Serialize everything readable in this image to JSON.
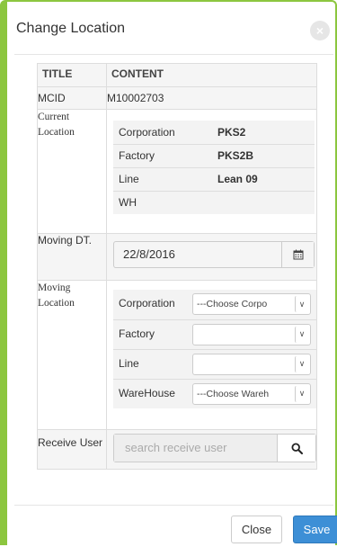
{
  "dialog": {
    "title": "Change Location",
    "close_icon": "×"
  },
  "table": {
    "headers": [
      "TITLE",
      "CONTENT"
    ],
    "mcid": {
      "label": "MCID",
      "value": "M10002703"
    },
    "current_location": {
      "label": "Current Location",
      "rows": [
        {
          "key": "Corporation",
          "value": "PKS2"
        },
        {
          "key": "Factory",
          "value": "PKS2B"
        },
        {
          "key": "Line",
          "value": "Lean 09"
        },
        {
          "key": "WH",
          "value": ""
        }
      ]
    },
    "moving_dt": {
      "label": "Moving DT.",
      "value": "22/8/2016",
      "icon": "calendar-icon"
    },
    "moving_location": {
      "label": "Moving Location",
      "rows": [
        {
          "key": "Corporation",
          "selected": "---Choose Corpo"
        },
        {
          "key": "Factory",
          "selected": ""
        },
        {
          "key": "Line",
          "selected": ""
        },
        {
          "key": "WareHouse",
          "selected": "---Choose Wareh"
        }
      ]
    },
    "receive_user": {
      "label": "Receive User",
      "placeholder": "search receive user",
      "icon": "search-icon"
    }
  },
  "footer": {
    "close_label": "Close",
    "save_label": "Save"
  },
  "colors": {
    "accent_border": "#8cc63f",
    "primary": "#3d8fd6"
  }
}
